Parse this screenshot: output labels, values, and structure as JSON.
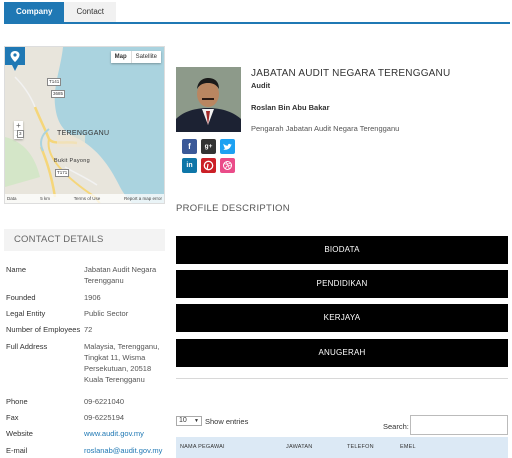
{
  "tabs": [
    {
      "label": "Company",
      "active": true
    },
    {
      "label": "Contact",
      "active": false
    }
  ],
  "map": {
    "type_buttons": [
      "Map",
      "Satellite"
    ],
    "zoom_in": "+",
    "zoom_out": "−",
    "city_label": "TERENGGANU",
    "town_label": "Bukit Payong",
    "road_shields": [
      "T141",
      "3685",
      "3",
      "T171"
    ],
    "footer_left": "Data",
    "footer_scale": "5 km",
    "footer_terms": "Terms of Use",
    "footer_report": "Report a map error",
    "water_color": "#aad3df",
    "land_color": "#e8e5dc",
    "marker_color": "#1f78b4"
  },
  "contact_details": {
    "heading": "CONTACT DETAILS",
    "rows": [
      {
        "key": "Name",
        "value": "Jabatan Audit Negara Terengganu"
      },
      {
        "key": "Founded",
        "value": "1906"
      },
      {
        "key": "Legal Entity",
        "value": "Public Sector"
      },
      {
        "key": "Number of Employees",
        "value": "72"
      },
      {
        "key": "Full Address",
        "value": "Malaysia, Terengganu, Tingkat 11, Wisma Persekutuan, 20518 Kuala Terengganu"
      },
      {
        "key": "Phone",
        "value": "09-6221040"
      },
      {
        "key": "Fax",
        "value": "09-6225194"
      },
      {
        "key": "Website",
        "value": "www.audit.gov.my"
      },
      {
        "key": "E-mail",
        "value": "roslanab@audit.gov.my"
      }
    ]
  },
  "profile": {
    "org_name": "JABATAN AUDIT NEGARA TERENGGANU",
    "org_type": "Audit",
    "person_name": "Roslan Bin Abu Bakar",
    "person_position": "Pengarah Jabatan Audit Negara Terengganu",
    "social_icons": [
      "facebook-icon",
      "google-plus-icon",
      "twitter-icon",
      "linkedin-icon",
      "pinterest-icon",
      "dribbble-icon"
    ]
  },
  "profile_description": {
    "title": "PROFILE DESCRIPTION",
    "sections": [
      "BIODATA",
      "PENDIDIKAN",
      "KERJAYA",
      "ANUGERAH"
    ]
  },
  "table": {
    "length_value": "10",
    "length_label": "Show  entries",
    "search_label": "Search:",
    "columns": [
      "NAMA PEGAWAI",
      "JAWATAN",
      "TELEFON",
      "EMEL"
    ]
  },
  "colors": {
    "accent": "#1f78b4",
    "button_bg": "#000000",
    "table_head_bg": "#dce9f5"
  }
}
